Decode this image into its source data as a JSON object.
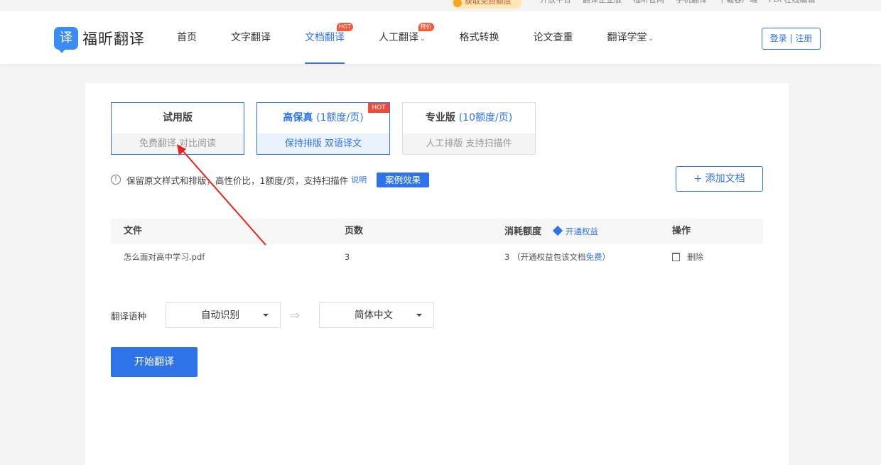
{
  "topbar": {
    "promo": "获取免费额度",
    "links": [
      "开放平台",
      "翻译企业版",
      "福昕官网",
      "手机翻译",
      "下载客户端",
      "PDF在线编辑"
    ]
  },
  "header": {
    "logo_mark": "译",
    "logo_text": "福昕翻译",
    "nav": [
      {
        "label": "首页"
      },
      {
        "label": "文字翻译"
      },
      {
        "label": "文档翻译",
        "badge": "HOT"
      },
      {
        "label": "人工翻译",
        "badge": "特价"
      },
      {
        "label": "格式转换"
      },
      {
        "label": "论文查重"
      },
      {
        "label": "翻译学堂"
      }
    ],
    "login": "登录 | 注册"
  },
  "versions": [
    {
      "title": "试用版",
      "quota": "",
      "sub": "免费翻译  对比阅读"
    },
    {
      "title": "高保真",
      "quota": "(1额度/页)",
      "sub": "保持排版  双语译文",
      "badge": "HOT"
    },
    {
      "title": "专业版",
      "quota": "(10额度/页)",
      "sub": "人工排版  支持扫描件"
    }
  ],
  "info": {
    "icon": "!",
    "text": "保留原文样式和排版，高性价比，1额度/页，支持扫描件",
    "link": "说明",
    "case_button": "案例效果"
  },
  "add_button": "+ 添加文档",
  "table": {
    "headers": {
      "file": "文件",
      "pages": "页数",
      "quota": "消耗额度",
      "benefit": "开通权益",
      "action": "操作"
    },
    "rows": [
      {
        "file": "怎么面对高中学习.pdf",
        "pages": "3",
        "quota_pre": "3 （开通权益包该文档",
        "quota_free": "免费",
        "quota_post": "）",
        "action": "删除"
      }
    ]
  },
  "language": {
    "label": "翻译语种",
    "source": "自动识别",
    "target": "简体中文",
    "swap": "⇒"
  },
  "start_button": "开始翻译",
  "colors": {
    "accent": "#2e73e8",
    "hot": "#f04a3a",
    "annotation": "#e8221c"
  }
}
